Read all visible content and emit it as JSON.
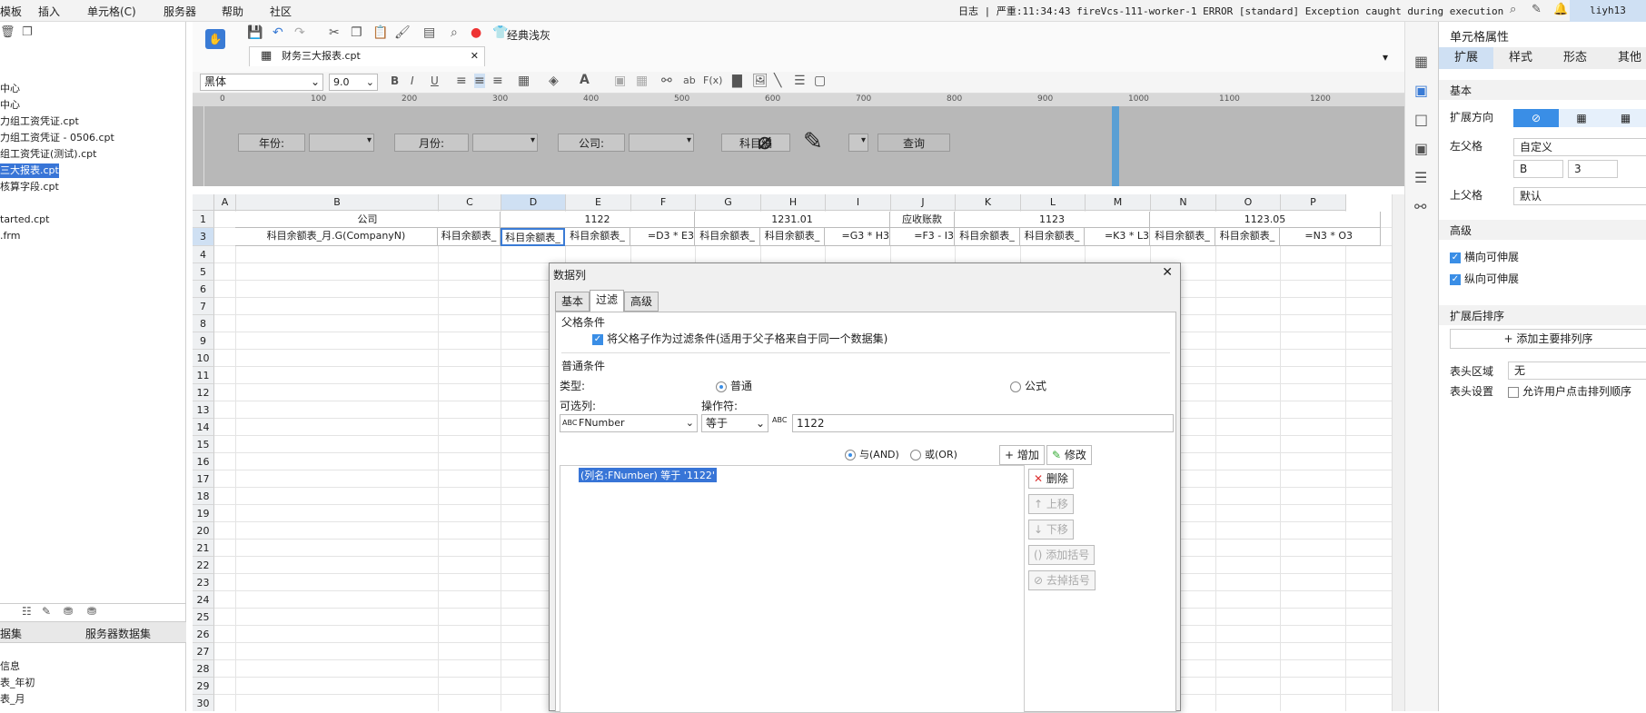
{
  "menubar": {
    "items": [
      "模板",
      "插入",
      "单元格(C)",
      "服务器",
      "帮助",
      "社区"
    ],
    "log": "日志 | 严重:11:34:43 fireVcs-111-worker-1 ERROR [standard] Exception caught during execution of c...",
    "user": "liyh13"
  },
  "left_tree": {
    "items": [
      "中心",
      "中心",
      "力组工资凭证.cpt",
      "力组工资凭证 - 0506.cpt",
      "组工资凭证(测试).cpt",
      "三大报表.cpt",
      "核算字段.cpt",
      "tarted.cpt",
      ".frm"
    ],
    "selected_index": 5
  },
  "left_bottom": {
    "tabs": [
      "据集",
      "服务器数据集"
    ],
    "items": [
      "信息",
      "表_年初",
      "表_月"
    ]
  },
  "toolbar": {
    "theme_label": "经典浅灰",
    "file_tab": "财务三大报表.cpt",
    "font_name": "黑体",
    "font_size": "9.0"
  },
  "ruler": {
    "ticks": [
      "0",
      "100",
      "200",
      "300",
      "400",
      "500",
      "600",
      "700",
      "800",
      "900",
      "1000",
      "1100",
      "1200"
    ]
  },
  "params": {
    "year_label": "年份:",
    "month_label": "月份:",
    "company_label": "公司:",
    "subject_label": "科目编",
    "query_button": "查询"
  },
  "grid": {
    "columns": [
      "A",
      "B",
      "C",
      "D",
      "E",
      "F",
      "G",
      "H",
      "I",
      "J",
      "K",
      "L",
      "M",
      "N",
      "O",
      "P"
    ],
    "rows": [
      "1",
      "3",
      "4",
      "5",
      "6",
      "7",
      "8",
      "9",
      "10",
      "11",
      "12",
      "13",
      "14",
      "15",
      "16",
      "17",
      "18",
      "19",
      "20",
      "21",
      "22",
      "23",
      "24",
      "25",
      "26",
      "27",
      "28",
      "29",
      "30"
    ],
    "row1": {
      "company": "公司",
      "g1122": "1122",
      "g123101": "1231.01",
      "receivable": "应收账款",
      "g1123": "1123",
      "g112305": "1123.05"
    },
    "row3": {
      "B": "科目余额表_月.G(CompanyN)",
      "C": "科目余额表_",
      "D": "科目余额表_",
      "E": "科目余额表_",
      "F": "=D3 * E3",
      "G": "科目余额表_",
      "H": "科目余额表_",
      "I": "=G3 * H3",
      "J": "=F3 - I3",
      "K": "科目余额表_",
      "L": "科目余额表_",
      "M": "=K3 * L3",
      "N": "科目余额表_",
      "O": "科目余额表_",
      "P": "=N3 * O3"
    }
  },
  "dialog": {
    "title": "数据列",
    "tabs": [
      "基本",
      "过滤",
      "高级"
    ],
    "active_tab": 1,
    "parent_section": "父格条件",
    "parent_check": "将父格子作为过滤条件(适用于父子格来自于同一个数据集)",
    "normal_section": "普通条件",
    "type_label": "类型:",
    "type_normal": "普通",
    "type_formula": "公式",
    "col_label": "可选列:",
    "op_label": "操作符:",
    "column_value": "FNumber",
    "operator_value": "等于",
    "value": "1122",
    "and_label": "与(AND)",
    "or_label": "或(OR)",
    "add_button": "增加",
    "modify_button": "修改",
    "condition": "(列名:FNumber) 等于 '1122'",
    "delete_button": "删除",
    "up_button": "上移",
    "down_button": "下移",
    "add_bracket_button": "添加括号",
    "remove_bracket_button": "去掉括号"
  },
  "right_panel": {
    "title": "单元格属性",
    "tabs": [
      "扩展",
      "样式",
      "形态",
      "其他"
    ],
    "basic_section": "基本",
    "expand_dir_label": "扩展方向",
    "left_parent_label": "左父格",
    "left_parent_value": "自定义",
    "left_parent_col": "B",
    "left_parent_row": "3",
    "top_parent_label": "上父格",
    "top_parent_value": "默认",
    "advanced_section": "高级",
    "h_expand": "横向可伸展",
    "v_expand": "纵向可伸展",
    "sort_section": "扩展后排序",
    "add_sort_button": "添加主要排列序",
    "header_area_label": "表头区域",
    "header_area_value": "无",
    "header_setting_label": "表头设置",
    "allow_sort": "允许用户点击排列顺序"
  }
}
